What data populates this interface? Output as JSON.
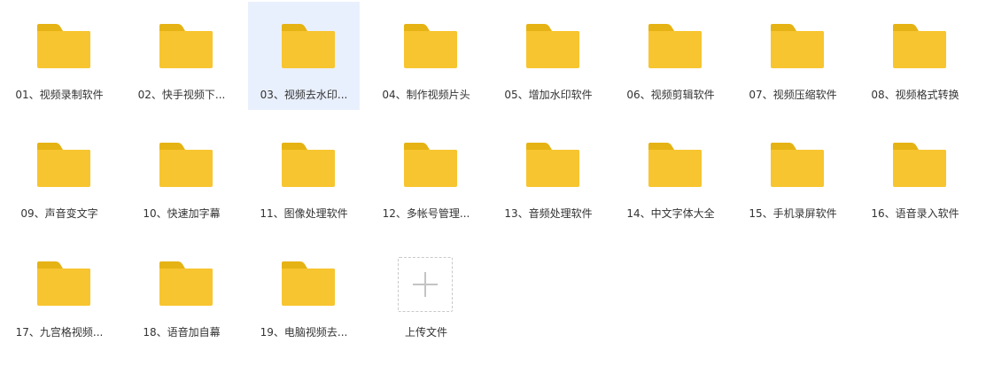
{
  "colors": {
    "folder_tab": "#E6B314",
    "folder_body": "#F7C530",
    "selected_bg": "#E9F0FD"
  },
  "folders": [
    {
      "label": "01、视频录制软件",
      "icon": "folder-icon",
      "selected": false
    },
    {
      "label": "02、快手视频下...",
      "icon": "folder-icon",
      "selected": false
    },
    {
      "label": "03、视频去水印...",
      "icon": "folder-icon",
      "selected": true
    },
    {
      "label": "04、制作视频片头",
      "icon": "folder-icon",
      "selected": false
    },
    {
      "label": "05、增加水印软件",
      "icon": "folder-icon",
      "selected": false
    },
    {
      "label": "06、视频剪辑软件",
      "icon": "folder-icon",
      "selected": false
    },
    {
      "label": "07、视频压缩软件",
      "icon": "folder-icon",
      "selected": false
    },
    {
      "label": "08、视频格式转换",
      "icon": "folder-icon",
      "selected": false
    },
    {
      "label": "09、声音变文字",
      "icon": "folder-icon",
      "selected": false
    },
    {
      "label": "10、快速加字幕",
      "icon": "folder-icon",
      "selected": false
    },
    {
      "label": "11、图像处理软件",
      "icon": "folder-icon",
      "selected": false
    },
    {
      "label": "12、多帐号管理...",
      "icon": "folder-icon",
      "selected": false
    },
    {
      "label": "13、音频处理软件",
      "icon": "folder-icon",
      "selected": false
    },
    {
      "label": "14、中文字体大全",
      "icon": "folder-icon",
      "selected": false
    },
    {
      "label": "15、手机录屏软件",
      "icon": "folder-icon",
      "selected": false
    },
    {
      "label": "16、语音录入软件",
      "icon": "folder-icon",
      "selected": false
    },
    {
      "label": "17、九宫格视频...",
      "icon": "folder-icon",
      "selected": false
    },
    {
      "label": "18、语音加自幕",
      "icon": "folder-icon",
      "selected": false
    },
    {
      "label": "19、电脑视频去...",
      "icon": "folder-icon",
      "selected": false
    }
  ],
  "upload": {
    "label": "上传文件",
    "icon": "plus-icon"
  }
}
